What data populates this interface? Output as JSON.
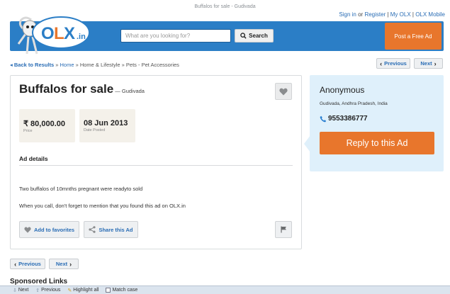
{
  "window": {
    "title": "Buffalos for sale - Gudivada"
  },
  "toplinks": {
    "sign_in": "Sign in",
    "or": " or ",
    "register": "Register",
    "sep1": " | ",
    "my_olx": "My OLX",
    "sep2": " | ",
    "mobile": "OLX Mobile"
  },
  "header": {
    "logo_text": "OLX.in",
    "search_placeholder": "What are you looking for?",
    "search_button": "Search",
    "post_ad": "Post a Free Ad"
  },
  "breadcrumb": {
    "back": "Back to Results",
    "sep": " » ",
    "home": "Home",
    "category": "Home & Lifestyle",
    "subcategory": "Pets - Pet Accessories"
  },
  "pager": {
    "previous": "Previous",
    "next": "Next"
  },
  "ad": {
    "title": "Buffalos for sale",
    "location_prefix": " — ",
    "location": "Gudivada",
    "price": "₹ 80,000.00",
    "price_label": "Price",
    "date": "08 Jun 2013",
    "date_label": "Date Posted",
    "details_heading": "Ad details",
    "description": "Two buffalos of 10mnths pregnant were readyto sold",
    "mention": "When you call, don't forget to mention that you found this ad on OLX.in",
    "add_favorites": "Add to favorites",
    "share": "Share this Ad"
  },
  "seller": {
    "name": "Anonymous",
    "location": "Gudivada, Andhra Pradesh, India",
    "phone": "9553386777",
    "reply": "Reply to this Ad"
  },
  "sponsored": "Sponsored Links",
  "findbar": {
    "next": "Next",
    "previous": "Previous",
    "highlight": "Highlight all",
    "match_case": "Match case"
  },
  "colors": {
    "header_blue": "#2b7ec6",
    "accent_orange": "#e8762c",
    "seller_panel": "#dff0fb",
    "link_blue": "#2a6db5"
  }
}
